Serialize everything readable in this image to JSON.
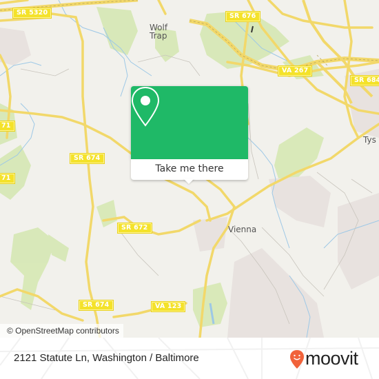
{
  "map": {
    "road_shields": [
      {
        "id": "sr5320",
        "label": "SR 5320"
      },
      {
        "id": "sr676",
        "label": "SR 676"
      },
      {
        "id": "va267",
        "label": "VA 267"
      },
      {
        "id": "sr684",
        "label": "SR 684"
      },
      {
        "id": "sr671a",
        "label": "71"
      },
      {
        "id": "sr671b",
        "label": "71"
      },
      {
        "id": "sr674a",
        "label": "SR 674"
      },
      {
        "id": "sr672",
        "label": "SR 672"
      },
      {
        "id": "sr674b",
        "label": "SR 674"
      },
      {
        "id": "va123",
        "label": "VA 123"
      }
    ],
    "places": [
      {
        "id": "wolf-trap",
        "label": "Wolf\nTrap",
        "line1": "Wolf",
        "line2": "Trap"
      },
      {
        "id": "vienna",
        "label": "Vienna"
      },
      {
        "id": "tysons",
        "label": "Tys"
      }
    ],
    "attribution": "© OpenStreetMap contributors"
  },
  "popup": {
    "icon": "map-pin-icon",
    "button_label": "Take me there",
    "color": "#1fb967"
  },
  "footer": {
    "address": "2121 Statute Ln, Washington / Baltimore",
    "logo_text": "moovit",
    "logo_icon": "moovit-pin-smile-icon",
    "logo_color": "#f1623a"
  }
}
